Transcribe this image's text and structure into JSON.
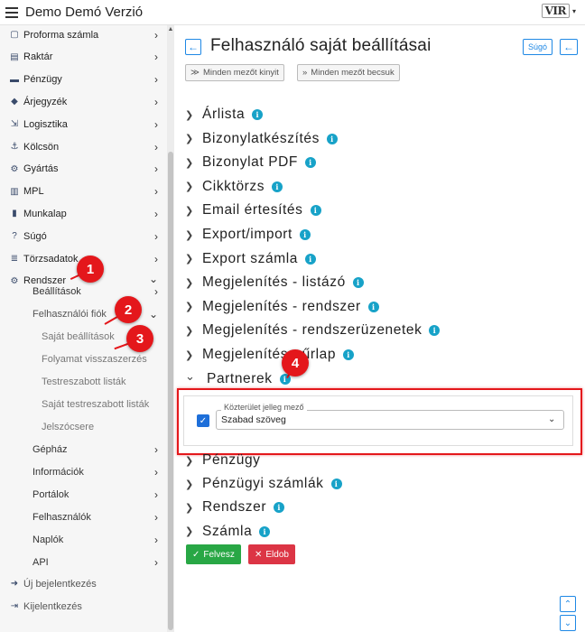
{
  "app": {
    "title": "Demo Demó Verzió",
    "logo": "VIR",
    "logo_caret": "▾"
  },
  "sidebar": {
    "items": [
      {
        "label": "Proforma számla",
        "icon": "document-icon"
      },
      {
        "label": "Raktár",
        "icon": "warehouse-icon"
      },
      {
        "label": "Pénzügy",
        "icon": "money-icon"
      },
      {
        "label": "Árjegyzék",
        "icon": "tag-icon"
      },
      {
        "label": "Logisztika",
        "icon": "logistics-icon"
      },
      {
        "label": "Kölcsön",
        "icon": "loan-icon"
      },
      {
        "label": "Gyártás",
        "icon": "gears-icon"
      },
      {
        "label": "MPL",
        "icon": "mpl-icon"
      },
      {
        "label": "Munkalap",
        "icon": "worksheet-icon"
      },
      {
        "label": "Súgó",
        "icon": "help-icon"
      },
      {
        "label": "Törzsadatok",
        "icon": "database-icon"
      },
      {
        "label": "Rendszer",
        "icon": "system-gear-icon"
      }
    ],
    "system_sub": [
      {
        "label": "Beállítások"
      },
      {
        "label": "Felhasználói fiók"
      }
    ],
    "account_sub": [
      {
        "label": "Saját beállítások"
      },
      {
        "label": "Folyamat visszaszerzés"
      },
      {
        "label": "Testreszabott listák"
      },
      {
        "label": "Saját testreszabott listák"
      },
      {
        "label": "Jelszócsere"
      }
    ],
    "system_sub2": [
      {
        "label": "Gépház"
      },
      {
        "label": "Információk"
      },
      {
        "label": "Portálok"
      },
      {
        "label": "Felhasználók"
      },
      {
        "label": "Naplók"
      },
      {
        "label": "API"
      }
    ],
    "bottom": [
      {
        "label": "Új bejelentkezés",
        "icon": "login-icon"
      },
      {
        "label": "Kijelentkezés",
        "icon": "logout-icon"
      }
    ]
  },
  "markers": [
    "1",
    "2",
    "3",
    "4"
  ],
  "main": {
    "title": "Felhasználó saját beállításai",
    "help_label": "Súgó",
    "expand_all": "Minden mezőt kinyit",
    "collapse_all": "Minden mezőt becsuk",
    "sections": [
      {
        "label": "Árlista",
        "info": true,
        "expanded": false
      },
      {
        "label": "Bizonylatkészítés",
        "info": true,
        "expanded": false
      },
      {
        "label": "Bizonylat PDF",
        "info": true,
        "expanded": false
      },
      {
        "label": "Cikktörzs",
        "info": true,
        "expanded": false
      },
      {
        "label": "Email értesítés",
        "info": true,
        "expanded": false
      },
      {
        "label": "Export/import",
        "info": true,
        "expanded": false
      },
      {
        "label": "Export számla",
        "info": true,
        "expanded": false
      },
      {
        "label": "Megjelenítés - listázó",
        "info": true,
        "expanded": false
      },
      {
        "label": "Megjelenítés - rendszer",
        "info": true,
        "expanded": false
      },
      {
        "label": "Megjelenítés - rendszerüzenetek",
        "info": true,
        "expanded": false
      },
      {
        "label": "Megjelenítés - űrlap",
        "info": true,
        "expanded": false
      },
      {
        "label": "Partnerek",
        "info": true,
        "expanded": true
      }
    ],
    "sections_after": [
      {
        "label": "Pénzügy",
        "info": false
      },
      {
        "label": "Pénzügyi számlák",
        "info": true
      },
      {
        "label": "Rendszer",
        "info": true
      },
      {
        "label": "Számla",
        "info": true
      }
    ],
    "partner_field": {
      "legend": "Közterület jelleg mező",
      "value": "Szabad szöveg",
      "checked": true
    },
    "save_label": "Felvesz",
    "discard_label": "Eldob"
  },
  "colors": {
    "accent": "#1e88e5",
    "marker": "#e4171b",
    "save": "#28a745",
    "discard": "#dc3545",
    "info": "#17a2c8"
  }
}
